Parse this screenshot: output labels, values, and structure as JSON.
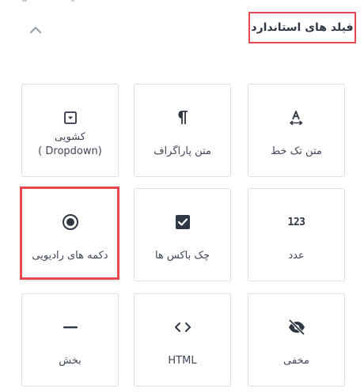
{
  "section": {
    "title": "فیلد های استاندارد",
    "toggle_icon": "chevron-up-icon"
  },
  "fields": [
    {
      "id": "single-line",
      "label": "متن تک خط",
      "icon": "text-cursor-icon"
    },
    {
      "id": "paragraph",
      "label": "متن پاراگراف",
      "icon": "pilcrow-icon"
    },
    {
      "id": "dropdown",
      "label_line1": "کشویی",
      "label_line2": "( Dropdown)",
      "icon": "dropdown-icon"
    },
    {
      "id": "number",
      "label": "عدد",
      "icon": "numbers-icon",
      "icon_text": "123"
    },
    {
      "id": "checkbox",
      "label": "چک باکس ها",
      "icon": "checkbox-icon"
    },
    {
      "id": "radio",
      "label": "دکمه های رادیویی",
      "icon": "radio-button-icon",
      "highlighted": true
    },
    {
      "id": "hidden",
      "label": "مخفی",
      "icon": "eye-off-icon"
    },
    {
      "id": "html",
      "label": "HTML",
      "icon": "code-icon"
    },
    {
      "id": "section-break",
      "label": "بخش",
      "icon": "divider-line-icon"
    }
  ],
  "colors": {
    "highlight": "#e8474d",
    "card_border": "#dcdfe5",
    "text": "#3f4756",
    "icon": "#2f3745"
  }
}
